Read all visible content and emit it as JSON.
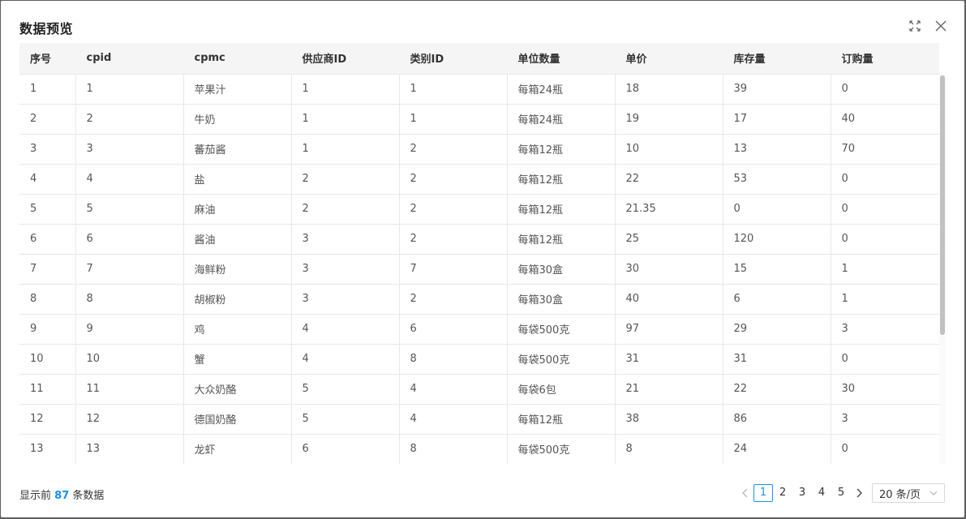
{
  "modal": {
    "title": "数据预览"
  },
  "table": {
    "columns": [
      "序号",
      "cpid",
      "cpmc",
      "供应商ID",
      "类别ID",
      "单位数量",
      "单价",
      "库存量",
      "订购量"
    ],
    "rows": [
      [
        "1",
        "1",
        "苹果汁",
        "1",
        "1",
        "每箱24瓶",
        "18",
        "39",
        "0"
      ],
      [
        "2",
        "2",
        "牛奶",
        "1",
        "1",
        "每箱24瓶",
        "19",
        "17",
        "40"
      ],
      [
        "3",
        "3",
        "蕃茄酱",
        "1",
        "2",
        "每箱12瓶",
        "10",
        "13",
        "70"
      ],
      [
        "4",
        "4",
        "盐",
        "2",
        "2",
        "每箱12瓶",
        "22",
        "53",
        "0"
      ],
      [
        "5",
        "5",
        "麻油",
        "2",
        "2",
        "每箱12瓶",
        "21.35",
        "0",
        "0"
      ],
      [
        "6",
        "6",
        "酱油",
        "3",
        "2",
        "每箱12瓶",
        "25",
        "120",
        "0"
      ],
      [
        "7",
        "7",
        "海鲜粉",
        "3",
        "7",
        "每箱30盒",
        "30",
        "15",
        "1"
      ],
      [
        "8",
        "8",
        "胡椒粉",
        "3",
        "2",
        "每箱30盒",
        "40",
        "6",
        "1"
      ],
      [
        "9",
        "9",
        "鸡",
        "4",
        "6",
        "每袋500克",
        "97",
        "29",
        "3"
      ],
      [
        "10",
        "10",
        "蟹",
        "4",
        "8",
        "每袋500克",
        "31",
        "31",
        "0"
      ],
      [
        "11",
        "11",
        "大众奶酪",
        "5",
        "4",
        "每袋6包",
        "21",
        "22",
        "30"
      ],
      [
        "12",
        "12",
        "德国奶酪",
        "5",
        "4",
        "每箱12瓶",
        "38",
        "86",
        "3"
      ],
      [
        "13",
        "13",
        "龙虾",
        "6",
        "8",
        "每袋500克",
        "8",
        "24",
        "0"
      ],
      [
        "",
        "",
        "",
        "",
        "",
        "",
        "",
        "",
        ""
      ]
    ]
  },
  "footer": {
    "summary_prefix": "显示前",
    "summary_count": "87",
    "summary_suffix": "条数据"
  },
  "pagination": {
    "pages": [
      "1",
      "2",
      "3",
      "4",
      "5"
    ],
    "current": "1",
    "page_size": "20 条/页"
  },
  "colors": {
    "accent": "#1890ff",
    "header_bg": "#f5f5f5",
    "border": "#e8e8e8"
  }
}
